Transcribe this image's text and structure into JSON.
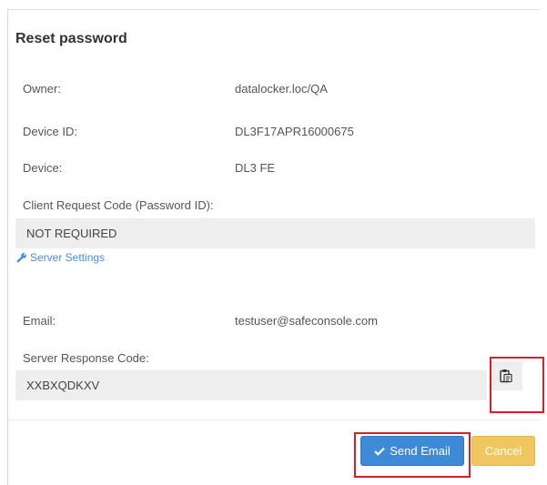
{
  "dialog": {
    "title": "Reset password"
  },
  "fields": {
    "owner_label": "Owner:",
    "owner_value": "datalocker.loc/QA",
    "device_id_label": "Device ID:",
    "device_id_value": "DL3F17APR16000675",
    "device_label": "Device:",
    "device_value": "DL3 FE",
    "client_code_label": "Client Request Code (Password ID):",
    "client_code_value": "NOT REQUIRED",
    "email_label": "Email:",
    "email_value": "testuser@safeconsole.com",
    "server_code_label": "Server Response Code:",
    "server_code_value": "XXBXQDKXV"
  },
  "links": {
    "server_settings": "Server Settings"
  },
  "buttons": {
    "send_email": "Send Email",
    "cancel": "Cancel"
  },
  "icons": {
    "server_settings": "wrench-icon",
    "copy": "clipboard-icon",
    "send_email": "checkmark-icon"
  },
  "colors": {
    "primary": "#3e8ad6",
    "warning": "#f0c75e",
    "link": "#4a8fd4",
    "highlight": "#d9202a"
  }
}
